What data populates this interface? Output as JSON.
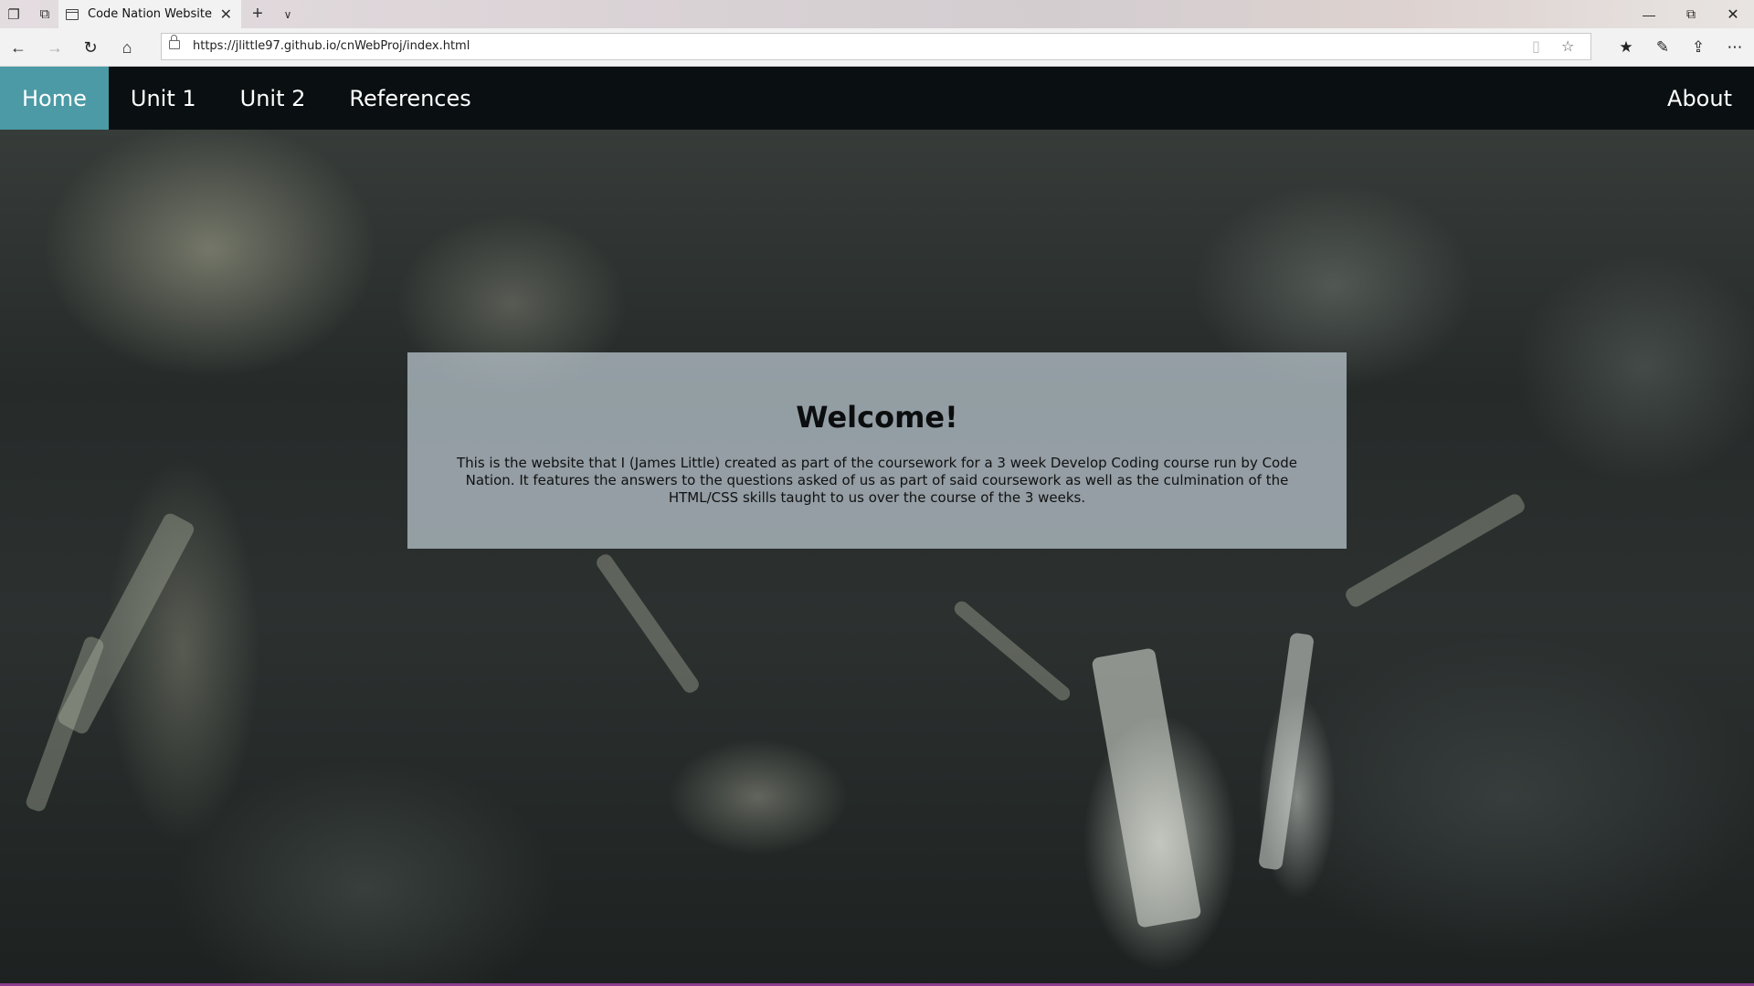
{
  "browser": {
    "tab_title": "Code Nation Website Pr",
    "url": "https://jlittle97.github.io/cnWebProj/index.html",
    "icons": {
      "tab_actions": "tab-actions-icon",
      "set_aside": "set-aside-tabs-icon",
      "new_tab": "plus-icon",
      "tab_preview": "chevron-down-icon",
      "back": "back-arrow-icon",
      "forward": "forward-arrow-icon",
      "refresh": "refresh-icon",
      "home": "home-icon",
      "reading_view": "reading-view-icon",
      "favorite": "star-icon",
      "favorites_hub": "favorites-list-icon",
      "web_note": "pen-icon",
      "share": "share-icon",
      "more": "ellipsis-icon",
      "minimize": "minimize-icon",
      "restore": "restore-icon",
      "close": "close-icon"
    }
  },
  "nav": {
    "items": [
      {
        "label": "Home",
        "active": true
      },
      {
        "label": "Unit 1",
        "active": false
      },
      {
        "label": "Unit 2",
        "active": false
      },
      {
        "label": "References",
        "active": false
      }
    ],
    "about_label": "About"
  },
  "welcome": {
    "title": "Welcome!",
    "text": "This is the website that I (James Little) created as part of the coursework for a 3 week Develop Coding course run by Code Nation. It features the answers to the questions asked of us as part of said coursework as well as the culmination of the HTML/CSS skills taught to us over the course of the 3 weeks."
  },
  "colors": {
    "nav_bg": "#0a1012",
    "nav_active": "#4b9aa6",
    "panel_bg": "rgba(190,202,210,0.72)"
  }
}
